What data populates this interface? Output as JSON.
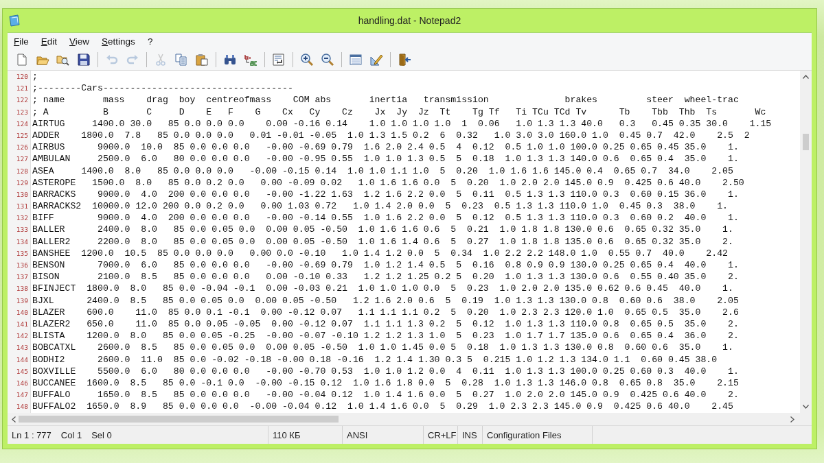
{
  "window": {
    "title": "handling.dat - Notepad2"
  },
  "menu": [
    "File",
    "Edit",
    "View",
    "Settings",
    "?"
  ],
  "toolbar": [
    {
      "kind": "new",
      "disabled": false
    },
    {
      "kind": "open",
      "disabled": false
    },
    {
      "kind": "browse",
      "disabled": false
    },
    {
      "kind": "save",
      "disabled": false
    },
    {
      "kind": "separator"
    },
    {
      "kind": "undo",
      "disabled": true
    },
    {
      "kind": "redo",
      "disabled": true
    },
    {
      "kind": "separator"
    },
    {
      "kind": "cut",
      "disabled": true
    },
    {
      "kind": "copy",
      "disabled": false
    },
    {
      "kind": "paste",
      "disabled": false
    },
    {
      "kind": "separator"
    },
    {
      "kind": "find",
      "disabled": false
    },
    {
      "kind": "replace",
      "disabled": false
    },
    {
      "kind": "separator"
    },
    {
      "kind": "wrap",
      "disabled": false
    },
    {
      "kind": "separator"
    },
    {
      "kind": "zoom-in",
      "disabled": false
    },
    {
      "kind": "zoom-out",
      "disabled": false
    },
    {
      "kind": "separator"
    },
    {
      "kind": "scheme",
      "disabled": false
    },
    {
      "kind": "customize",
      "disabled": false
    },
    {
      "kind": "separator"
    },
    {
      "kind": "exit",
      "disabled": false
    }
  ],
  "editor": {
    "lines": [
      {
        "number": "120",
        "text": ";"
      },
      {
        "number": "121",
        "text": ";--------Cars-----------------------------------"
      },
      {
        "number": "122",
        "text": "; name       mass    drag  boy  centreofmass    COM abs       inertia   transmission              brakes         steer  wheel-trac"
      },
      {
        "number": "123",
        "text": "; A          B       C     D    E   F    G    Cx   Cy    Cz    Jx  Jy  Jz  Tt    Tg Tf   Ti TCu TCd Tv      Tb    Tbb  Thb  Ts       Wc"
      },
      {
        "number": "124",
        "text": "AIRTUG     1400.0 30.0   85 0.0 0.0 0.0    0.00 -0.16 0.14    1.0 1.0 1.0 1.0  1  0.06   1.0 1.3 1.3 40.0   0.3   0.45 0.35 30.0    1.15"
      },
      {
        "number": "125",
        "text": "ADDER    1800.0  7.8   85 0.0 0.0 0.0   0.01 -0.01 -0.05  1.0 1.3 1.5 0.2  6  0.32   1.0 3.0 3.0 160.0 1.0  0.45 0.7  42.0    2.5  2"
      },
      {
        "number": "126",
        "text": "AIRBUS      9000.0  10.0  85 0.0 0.0 0.0   -0.00 -0.69 0.79  1.6 2.0 2.4 0.5  4  0.12  0.5 1.0 1.0 100.0 0.25 0.65 0.45 35.0    1."
      },
      {
        "number": "127",
        "text": "AMBULAN     2500.0  6.0   80 0.0 0.0 0.0   -0.00 -0.95 0.55  1.0 1.0 1.3 0.5  5  0.18  1.0 1.3 1.3 140.0 0.6  0.65 0.4  35.0    1."
      },
      {
        "number": "128",
        "text": "ASEA     1400.0  8.0   85 0.0 0.0 0.0   -0.00 -0.15 0.14  1.0 1.0 1.1 1.0  5  0.20  1.0 1.6 1.6 145.0 0.4  0.65 0.7  34.0    2.05"
      },
      {
        "number": "129",
        "text": "ASTEROPE   1500.0  8.0   85 0.0 0.2 0.0   0.00 -0.09 0.02   1.0 1.6 1.6 0.0  5  0.20  1.0 2.0 2.0 145.0 0.9  0.425 0.6 40.0    2.50"
      },
      {
        "number": "130",
        "text": "BARRACKS    9000.0  4.0  200 0.0 0.0 0.0   -0.00 -1.22 1.63  1.2 1.6 2.2 0.0  5  0.11  0.5 1.3 1.3 110.0 0.3  0.60 0.15 36.0    1."
      },
      {
        "number": "131",
        "text": "BARRACKS2  10000.0 12.0 200 0.0 0.2 0.0   0.00 1.03 0.72   1.0 1.4 2.0 0.0  5  0.23  0.5 1.3 1.3 110.0 1.0  0.45 0.3  38.0    1."
      },
      {
        "number": "132",
        "text": "BIFF        9000.0  4.0  200 0.0 0.0 0.0   -0.00 -0.14 0.55  1.0 1.6 2.2 0.0  5  0.12  0.5 1.3 1.3 110.0 0.3  0.60 0.2  40.0    1."
      },
      {
        "number": "133",
        "text": "BALLER      2400.0  8.0   85 0.0 0.05 0.0  0.00 0.05 -0.50  1.0 1.6 1.6 0.6  5  0.21  1.0 1.8 1.8 130.0 0.6  0.65 0.32 35.0    1."
      },
      {
        "number": "134",
        "text": "BALLER2     2200.0  8.0   85 0.0 0.05 0.0  0.00 0.05 -0.50  1.0 1.6 1.4 0.6  5  0.27  1.0 1.8 1.8 135.0 0.6  0.65 0.32 35.0    2."
      },
      {
        "number": "135",
        "text": "BANSHEE  1200.0  10.5  85 0.0 0.0 0.0   0.00 0.0 -0.10   1.0 1.4 1.2 0.0  5  0.34  1.0 2.2 2.2 148.0 1.0  0.55 0.7  40.0    2.42"
      },
      {
        "number": "136",
        "text": "BENSON      7000.0  6.0   85 0.0 0.0 0.0   -0.00 -0.69 0.79  1.0 1.2 1.4 0.5  5  0.16  0.8 0.9 0.9 130.0 0.25 0.65 0.4  40.0    1."
      },
      {
        "number": "137",
        "text": "BISON       2100.0  8.5   85 0.0 0.0 0.0   0.00 -0.10 0.33   1.2 1.2 1.25 0.2 5  0.20  1.0 1.3 1.3 130.0 0.6  0.55 0.40 35.0    2."
      },
      {
        "number": "138",
        "text": "BFINJECT  1800.0  8.0   85 0.0 -0.04 -0.1  0.00 -0.03 0.21  1.0 1.0 1.0 0.0  5  0.23  1.0 2.0 2.0 135.0 0.62 0.6 0.45  40.0    1."
      },
      {
        "number": "139",
        "text": "BJXL      2400.0  8.5   85 0.0 0.05 0.0  0.00 0.05 -0.50   1.2 1.6 2.0 0.6  5  0.19  1.0 1.3 1.3 130.0 0.8  0.60 0.6  38.0    2.05"
      },
      {
        "number": "140",
        "text": "BLAZER    600.0    11.0  85 0.0 0.1 -0.1  0.00 -0.12 0.07   1.1 1.1 1.1 0.2  5  0.20  1.0 2.3 2.3 120.0 1.0  0.65 0.5  35.0    2.6"
      },
      {
        "number": "141",
        "text": "BLAZER2   650.0    11.0  85 0.0 0.05 -0.05  0.00 -0.12 0.07  1.1 1.1 1.3 0.2  5  0.12  1.0 1.3 1.3 110.0 0.8  0.65 0.5  35.0    2."
      },
      {
        "number": "142",
        "text": "BLISTA    1200.0  8.0   85 0.0 0.05 -0.25  -0.00 -0.07 -0.10 1.2 1.2 1.3 1.0  5  0.23  1.0 1.7 1.7 135.0 0.6  0.65 0.4  36.0    2."
      },
      {
        "number": "143",
        "text": "BOBCATXL    2600.0  8.5   85 0.0 0.05 0.0  0.00 0.05 -0.50  1.0 1.0 1.45 0.0 5  0.18  1.0 1.3 1.3 130.0 0.8  0.60 0.6  35.0    1."
      },
      {
        "number": "144",
        "text": "BODHI2      2600.0  11.0  85 0.0 -0.02 -0.18 -0.00 0.18 -0.16  1.2 1.4 1.30 0.3 5  0.215 1.0 1.2 1.3 134.0 1.1  0.60 0.45 38.0"
      },
      {
        "number": "145",
        "text": "BOXVILLE    5500.0  6.0   80 0.0 0.0 0.0   -0.00 -0.70 0.53  1.0 1.0 1.2 0.0  4  0.11  1.0 1.3 1.3 100.0 0.25 0.60 0.3  40.0    1."
      },
      {
        "number": "146",
        "text": "BUCCANEE  1600.0  8.5   85 0.0 -0.1 0.0  -0.00 -0.15 0.12  1.0 1.6 1.8 0.0  5  0.28  1.0 1.3 1.3 146.0 0.8  0.65 0.8  35.0    2.15"
      },
      {
        "number": "147",
        "text": "BUFFALO     1650.0  8.5   85 0.0 0.0 0.0   -0.00 -0.04 0.12  1.0 1.4 1.6 0.0  5  0.27  1.0 2.0 2.0 145.0 0.9  0.425 0.6 40.0    2."
      },
      {
        "number": "148",
        "text": "BUFFALO2  1650.0  8.9   85 0.0 0.0 0.0  -0.00 -0.04 0.12  1.0 1.4 1.6 0.0  5  0.29  1.0 2.3 2.3 145.0 0.9  0.425 0.6 40.0    2.45"
      }
    ]
  },
  "status_bar": [
    [
      "Ln 1 : 777",
      "Col 1",
      "Sel 0"
    ],
    [
      "110 КБ"
    ],
    [
      "ANSI"
    ],
    [
      "CR+LF"
    ],
    [
      "INS"
    ],
    [
      "Configuration Files"
    ]
  ]
}
